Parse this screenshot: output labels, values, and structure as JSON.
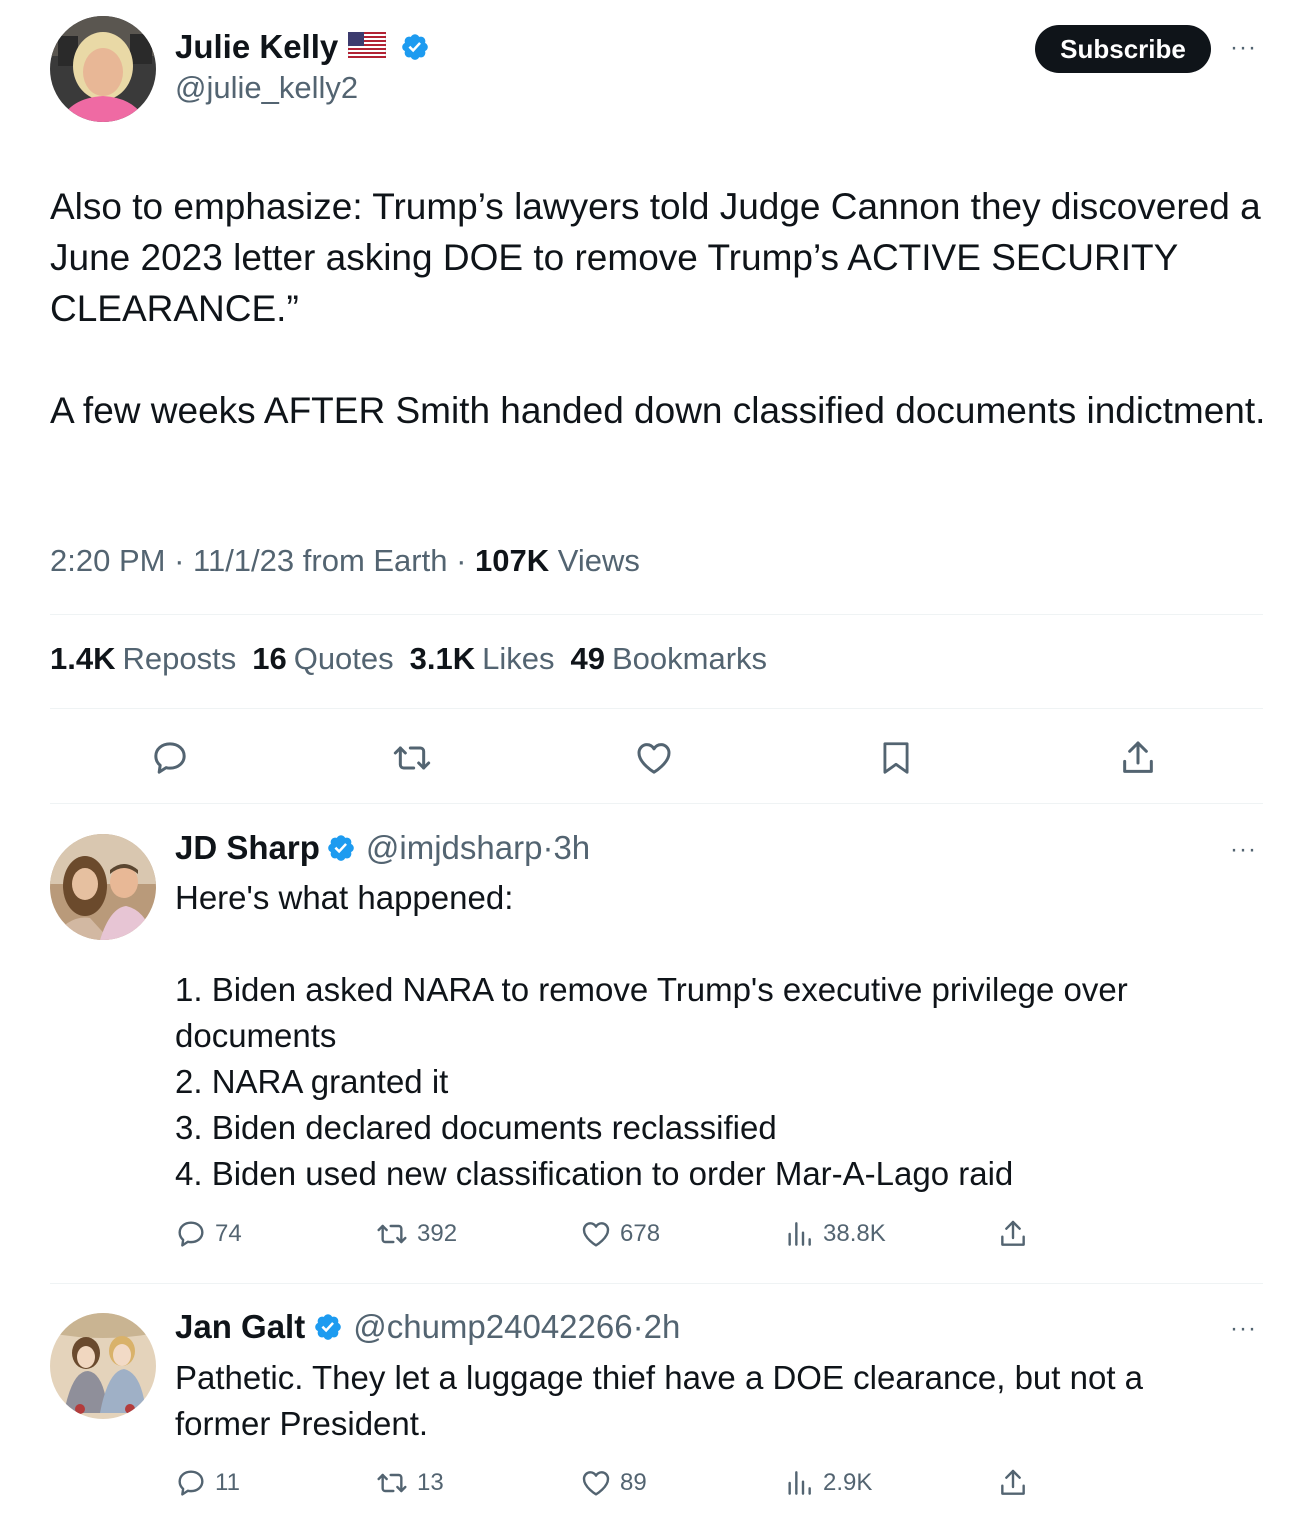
{
  "main_tweet": {
    "author_name": "Julie Kelly",
    "author_flag": "🇺🇸",
    "author_handle": "@julie_kelly2",
    "subscribe_label": "Subscribe",
    "more_label": "···",
    "text": "Also to emphasize: Trump’s lawyers told Judge Cannon they discovered a June 2023 letter asking DOE to remove Trump’s ACTIVE SECURITY CLEARANCE.”\n\nA few weeks AFTER Smith handed down classified documents indictment.",
    "time": "2:20 PM",
    "sep1": " · ",
    "date": "11/1/23",
    "from": " from Earth",
    "sep2": " · ",
    "views_count": "107K",
    "views_label": " Views",
    "stats": {
      "reposts_count": "1.4K",
      "reposts_label": "Reposts",
      "quotes_count": "16",
      "quotes_label": "Quotes",
      "likes_count": "3.1K",
      "likes_label": "Likes",
      "bookmarks_count": "49",
      "bookmarks_label": "Bookmarks"
    },
    "icons": [
      "reply-icon",
      "repost-icon",
      "like-icon",
      "bookmark-icon",
      "share-icon"
    ]
  },
  "replies": [
    {
      "name": "JD Sharp",
      "handle": "@imjdsharp",
      "dot": " · ",
      "time": "3h",
      "more_label": "···",
      "text": "Here's what happened:\n\n1. Biden asked NARA to remove Trump's executive privilege over documents\n2. NARA granted it\n3. Biden declared documents reclassified\n4. Biden used new classification to order Mar-A-Lago raid",
      "replies": "74",
      "reposts": "392",
      "likes": "678",
      "views": "38.8K"
    },
    {
      "name": "Jan Galt",
      "handle": "@chump24042266",
      "dot": " · ",
      "time": "2h",
      "more_label": "···",
      "text": "Pathetic. They let a luggage thief have a DOE clearance, but not a former President.",
      "replies": "11",
      "reposts": "13",
      "likes": "89",
      "views": "2.9K"
    }
  ],
  "colors": {
    "text": "#0f1419",
    "secondary": "#536471",
    "verified": "#1d9bf0",
    "divider": "#eff3f4",
    "button": "#0f1419"
  }
}
